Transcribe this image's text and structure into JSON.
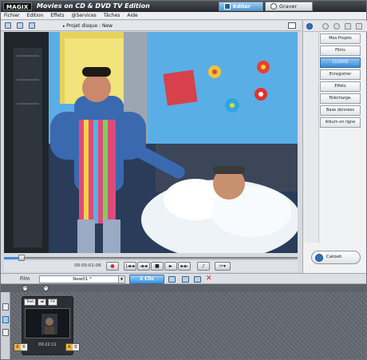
{
  "app": {
    "logo": "MAGIX",
    "title": "Movies on CD & DVD TV Edition"
  },
  "modes": {
    "edit": "Editer",
    "burn": "Graver"
  },
  "menu": [
    "Fichier",
    "Edition",
    "Effets",
    "@Services",
    "Tâches",
    "Aide"
  ],
  "toolbar": {
    "project_label": "Projet disque : New"
  },
  "transport": {
    "timecode": "00:00:01:06",
    "progress_fraction": 0.06
  },
  "nav": {
    "items": [
      "Mes Projets",
      "Films",
      "CD/DVD",
      "Enregistrer",
      "Effets",
      "Télécharge.",
      "Base données",
      "Album en ligne"
    ],
    "active": "CD/DVD",
    "catooh": "Catooh"
  },
  "storyboard": {
    "film_label": "Film",
    "movie_name": "New01 *",
    "clip_mode": "1 Clic"
  },
  "timeline": {
    "markers": [
      "S",
      "E"
    ],
    "clip": {
      "text_label": "Text",
      "audio_label": "◄)",
      "fx_label": "FX",
      "duration": "00:22:11"
    },
    "ab": [
      "A",
      "B"
    ]
  }
}
